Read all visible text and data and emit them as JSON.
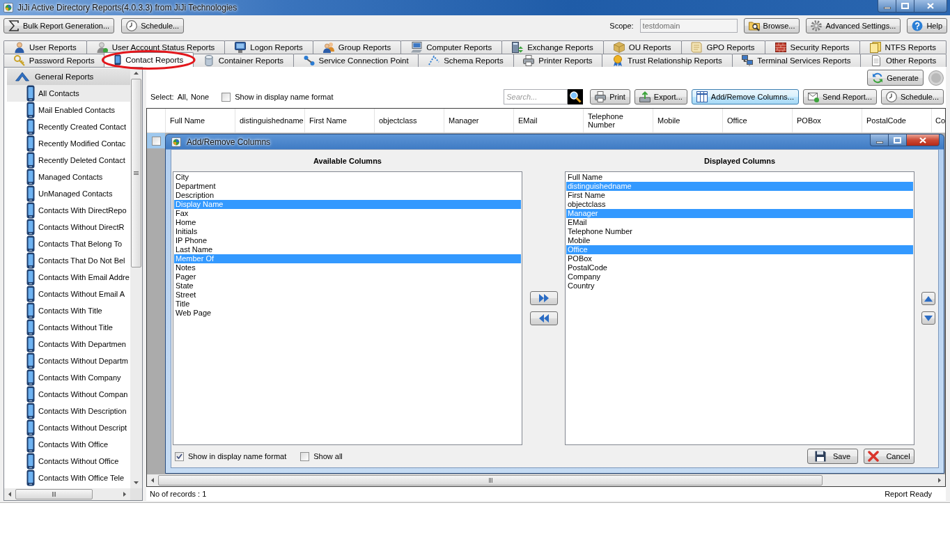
{
  "window": {
    "title": "JiJi Active Directory Reports(4.0.3.3) from JiJi Technologies"
  },
  "toolbar": {
    "left_buttons": [
      {
        "label": "Bulk Report Generation..."
      },
      {
        "label": "Schedule..."
      }
    ],
    "scope": {
      "label": "Scope:",
      "value": "testdomain",
      "disabled": true
    },
    "right_buttons": [
      {
        "label": "Browse..."
      },
      {
        "label": "Advanced Settings..."
      },
      {
        "label": "Help"
      }
    ]
  },
  "tab_rows": [
    [
      {
        "label": "User Reports",
        "selected": false,
        "circled": false
      },
      {
        "label": "User Account Status Reports",
        "selected": false,
        "circled": false
      },
      {
        "label": "Logon Reports",
        "selected": false,
        "circled": false
      },
      {
        "label": "Group Reports",
        "selected": false,
        "circled": false
      },
      {
        "label": "Computer Reports",
        "selected": false,
        "circled": false
      },
      {
        "label": "Exchange Reports",
        "selected": false,
        "circled": false
      },
      {
        "label": "OU Reports",
        "selected": false,
        "circled": false
      },
      {
        "label": "GPO Reports",
        "selected": false,
        "circled": false
      },
      {
        "label": "Security Reports",
        "selected": false,
        "circled": false
      },
      {
        "label": "NTFS Reports",
        "selected": false,
        "circled": false
      }
    ],
    [
      {
        "label": "Password Reports",
        "selected": false,
        "circled": false
      },
      {
        "label": "Contact Reports",
        "selected": true,
        "circled": true
      },
      {
        "label": "Container Reports",
        "selected": false,
        "circled": false
      },
      {
        "label": "Service Connection Point",
        "selected": false,
        "circled": false
      },
      {
        "label": "Schema Reports",
        "selected": false,
        "circled": false
      },
      {
        "label": "Printer Reports",
        "selected": false,
        "circled": false
      },
      {
        "label": "Trust Relationship Reports",
        "selected": false,
        "circled": false
      },
      {
        "label": "Terminal Services Reports",
        "selected": false,
        "circled": false
      },
      {
        "label": "Other Reports",
        "selected": false,
        "circled": false
      }
    ]
  ],
  "sidebar": {
    "group": {
      "label": "General Reports",
      "expanded": true
    },
    "items": [
      {
        "label": "All Contacts",
        "selected": true
      },
      {
        "label": "Mail Enabled Contacts",
        "selected": false
      },
      {
        "label": "Recently Created Contact",
        "selected": false
      },
      {
        "label": "Recently Modified Contac",
        "selected": false
      },
      {
        "label": "Recently Deleted Contact",
        "selected": false
      },
      {
        "label": "Managed Contacts",
        "selected": false
      },
      {
        "label": "UnManaged Contacts",
        "selected": false
      },
      {
        "label": "Contacts With DirectRepo",
        "selected": false
      },
      {
        "label": "Contacts Without DirectR",
        "selected": false
      },
      {
        "label": "Contacts That Belong To",
        "selected": false
      },
      {
        "label": "Contacts That Do Not Bel",
        "selected": false
      },
      {
        "label": "Contacts With Email Addre",
        "selected": false
      },
      {
        "label": "Contacts Without Email A",
        "selected": false
      },
      {
        "label": "Contacts With Title",
        "selected": false
      },
      {
        "label": "Contacts Without Title",
        "selected": false
      },
      {
        "label": "Contacts With Departmen",
        "selected": false
      },
      {
        "label": "Contacts Without Departm",
        "selected": false
      },
      {
        "label": "Contacts With Company",
        "selected": false
      },
      {
        "label": "Contacts Without Compan",
        "selected": false
      },
      {
        "label": "Contacts With Description",
        "selected": false
      },
      {
        "label": "Contacts Without Descript",
        "selected": false
      },
      {
        "label": "Contacts With Office",
        "selected": false
      },
      {
        "label": "Contacts Without Office",
        "selected": false
      },
      {
        "label": "Contacts With Office Tele",
        "selected": false
      }
    ]
  },
  "report": {
    "generate_button": "Generate",
    "select": {
      "label": "Select:",
      "links": [
        "All,",
        "None"
      ]
    },
    "display_name_checkbox": {
      "label": "Show in display name format",
      "checked": false
    },
    "search": {
      "placeholder": "Search..."
    },
    "actions": [
      {
        "label": "Print",
        "active": false
      },
      {
        "label": "Export...",
        "active": false
      },
      {
        "label": "Add/Remove Columns...",
        "active": true
      },
      {
        "label": "Send Report...",
        "active": false
      },
      {
        "label": "Schedule...",
        "active": false
      }
    ]
  },
  "table": {
    "columns": [
      "Full Name",
      "distinguishedname",
      "First Name",
      "objectclass",
      "Manager",
      "EMail",
      "Telephone Number",
      "Mobile",
      "Office",
      "POBox",
      "PostalCode",
      "Co"
    ],
    "rows": [
      {
        "checked": false,
        "selected": true
      }
    ]
  },
  "dialog": {
    "title": "Add/Remove Columns",
    "available": {
      "heading": "Available Columns",
      "items": [
        {
          "label": "City",
          "selected": false
        },
        {
          "label": "Department",
          "selected": false
        },
        {
          "label": "Description",
          "selected": false
        },
        {
          "label": "Display Name",
          "selected": true
        },
        {
          "label": "Fax",
          "selected": false
        },
        {
          "label": "Home",
          "selected": false
        },
        {
          "label": "Initials",
          "selected": false
        },
        {
          "label": "IP Phone",
          "selected": false
        },
        {
          "label": "Last Name",
          "selected": false
        },
        {
          "label": "Member Of",
          "selected": true
        },
        {
          "label": "Notes",
          "selected": false
        },
        {
          "label": "Pager",
          "selected": false
        },
        {
          "label": "State",
          "selected": false
        },
        {
          "label": "Street",
          "selected": false
        },
        {
          "label": "Title",
          "selected": false
        },
        {
          "label": "Web Page",
          "selected": false
        }
      ]
    },
    "displayed": {
      "heading": "Displayed Columns",
      "items": [
        {
          "label": "Full Name",
          "selected": false
        },
        {
          "label": "distinguishedname",
          "selected": true
        },
        {
          "label": "First Name",
          "selected": false
        },
        {
          "label": "objectclass",
          "selected": false
        },
        {
          "label": "Manager",
          "selected": true
        },
        {
          "label": "EMail",
          "selected": false
        },
        {
          "label": "Telephone Number",
          "selected": false
        },
        {
          "label": "Mobile",
          "selected": false
        },
        {
          "label": "Office",
          "selected": true
        },
        {
          "label": "POBox",
          "selected": false
        },
        {
          "label": "PostalCode",
          "selected": false
        },
        {
          "label": "Company",
          "selected": false
        },
        {
          "label": "Country",
          "selected": false
        }
      ]
    },
    "options": [
      {
        "label": "Show in display name format",
        "checked": true
      },
      {
        "label": "Show all",
        "checked": false
      }
    ],
    "buttons": [
      {
        "label": "Save"
      },
      {
        "label": "Cancel"
      }
    ]
  },
  "status_bar": {
    "records": "No of records : 1",
    "status": "Report Ready"
  }
}
